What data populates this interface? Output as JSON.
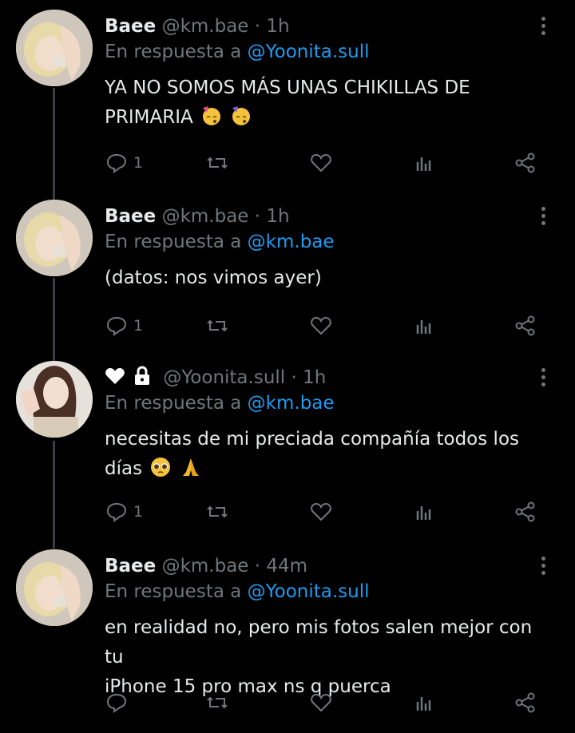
{
  "tweets": [
    {
      "name": "Baee",
      "handle": "@km.bae",
      "time": "· 1h",
      "reply_prefix": "En respuesta a",
      "reply_to": "@Yoonita.sull",
      "text_line1": "YA NO SOMOS MÁS UNAS CHIKILLAS DE",
      "text_line2": "PRIMARIA",
      "emojis": [
        "partying-face-emoji",
        "partying-face-emoji"
      ],
      "replies": "1",
      "avatar": "blonde"
    },
    {
      "name": "Baee",
      "handle": "@km.bae",
      "time": "· 1h",
      "reply_prefix": "En respuesta a",
      "reply_to": "@km.bae",
      "text_line1": "(datos: nos vimos ayer)",
      "text_line2": "",
      "replies": "1",
      "avatar": "blonde"
    },
    {
      "name": "",
      "handle": "@Yoonita.sull",
      "time": "· 1h",
      "reply_prefix": "En respuesta a",
      "reply_to": "@km.bae",
      "text_line1": "necesitas de mi preciada compañía todos los",
      "text_line2": "días",
      "emojis": [
        "pleading-face-emoji",
        "folded-hands-emoji"
      ],
      "replies": "1",
      "avatar": "dark"
    },
    {
      "name": "Baee",
      "handle": "@km.bae",
      "time": "· 44m",
      "reply_prefix": "En respuesta a",
      "reply_to": "@Yoonita.sull",
      "text_line1": "en realidad no, pero mis fotos salen mejor con tu",
      "text_line2": "iPhone 15 pro max ns q puerca",
      "replies": "",
      "avatar": "blonde"
    }
  ],
  "colors": {
    "background": "#000000",
    "text": "#e7e9ea",
    "muted": "#71767b",
    "link": "#1d9bf0",
    "thread_line": "#3a3d41"
  }
}
